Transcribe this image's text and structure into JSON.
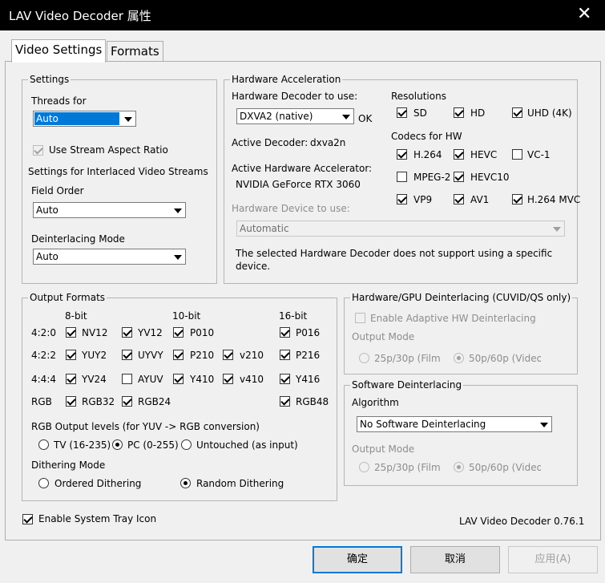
{
  "window": {
    "title": "LAV Video Decoder 属性",
    "close_glyph": "✕"
  },
  "tabs": [
    "Video Settings",
    "Formats"
  ],
  "settings": {
    "group": "Settings",
    "threads_label": "Threads for",
    "threads_value": "Auto",
    "stream_aspect": "Use Stream Aspect Ratio",
    "interlaced_heading": "Settings for Interlaced Video Streams",
    "field_order_label": "Field Order",
    "field_order_value": "Auto",
    "deint_mode_label": "Deinterlacing Mode",
    "deint_mode_value": "Auto"
  },
  "hwaccel": {
    "group": "Hardware Acceleration",
    "decoder_label": "Hardware Decoder to use:",
    "decoder_value": "DXVA2 (native)",
    "ok": "OK",
    "active_decoder_label": "Active Decoder:",
    "active_decoder_value": "dxva2n",
    "active_accel_label": "Active Hardware Accelerator:",
    "active_accel_value": "NVIDIA GeForce RTX 3060",
    "device_label": "Hardware Device to use:",
    "device_value": "Automatic",
    "note_line1": "The selected Hardware Decoder does not support using a specific",
    "note_line2": "device.",
    "resolutions_label": "Resolutions",
    "resolutions": [
      "SD",
      "HD",
      "UHD (4K)"
    ],
    "codecs_label": "Codecs for HW",
    "codecs_row1": [
      "H.264",
      "HEVC",
      "VC-1"
    ],
    "codecs_row2": [
      "MPEG-2",
      "HEVC10"
    ],
    "codecs_row3": [
      "VP9",
      "AV1",
      "H.264 MVC"
    ]
  },
  "output": {
    "group": "Output Formats",
    "col_8bit": "8-bit",
    "col_10bit": "10-bit",
    "col_16bit": "16-bit",
    "rows": [
      "4:2:0",
      "4:2:2",
      "4:4:4",
      "RGB"
    ],
    "f420": [
      "NV12",
      "YV12",
      "P010",
      "P016"
    ],
    "f422": [
      "YUY2",
      "UYVY",
      "P210",
      "v210",
      "P216"
    ],
    "f444": [
      "YV24",
      "AYUV",
      "Y410",
      "v410",
      "Y416"
    ],
    "frgb": [
      "RGB32",
      "RGB24",
      "RGB48"
    ],
    "levels_label": "RGB Output levels (for YUV -> RGB conversion)",
    "levels": [
      "TV (16-235)",
      "PC (0-255)",
      "Untouched (as input)"
    ],
    "dither_label": "Dithering Mode",
    "dither": [
      "Ordered Dithering",
      "Random Dithering"
    ]
  },
  "hwdeint": {
    "group": "Hardware/GPU Deinterlacing (CUVID/QS only)",
    "adaptive": "Enable Adaptive HW Deinterlacing",
    "output_mode": "Output Mode",
    "mode1": "25p/30p (Film)",
    "mode2": "50p/60p (Video)"
  },
  "swdeint": {
    "group": "Software Deinterlacing",
    "algorithm_label": "Algorithm",
    "algorithm_value": "No Software Deinterlacing",
    "output_mode": "Output Mode",
    "mode1": "25p/30p (Film)",
    "mode2": "50p/60p (Video)"
  },
  "footer": {
    "tray": "Enable System Tray Icon",
    "version": "LAV Video Decoder 0.76.1"
  },
  "buttons": {
    "ok": "确定",
    "cancel": "取消",
    "apply": "应用(A)"
  }
}
